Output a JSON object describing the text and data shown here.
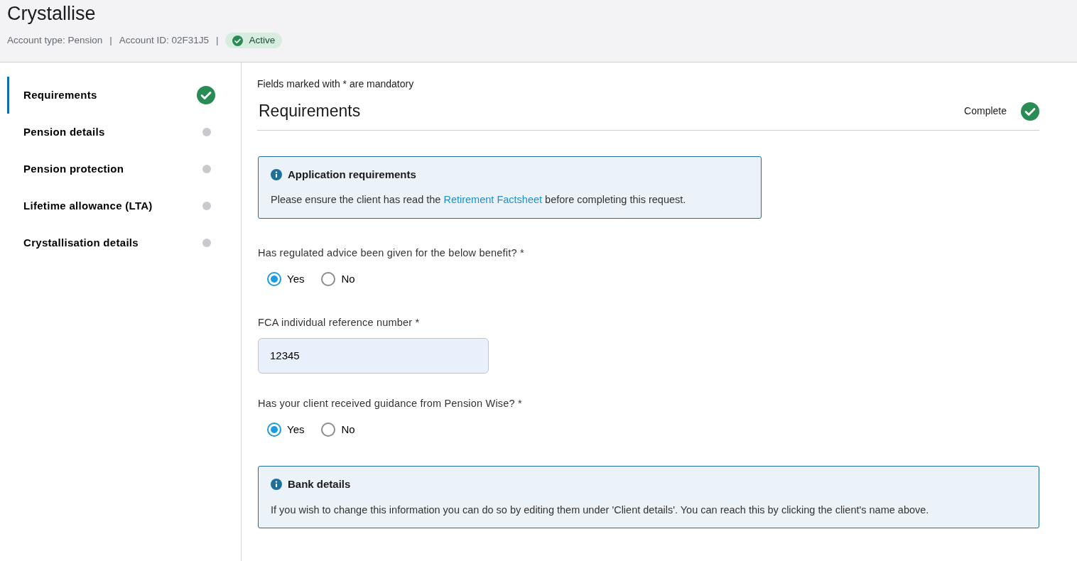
{
  "header": {
    "title": "Crystallise",
    "account_type": "Account type: Pension",
    "separator_1": "|",
    "account_id": "Account ID: 02F31J5",
    "separator_2": "|",
    "status": {
      "label": "Active",
      "kind": "active"
    }
  },
  "sidebar": {
    "items": [
      {
        "label": "Requirements",
        "selected": true,
        "complete": true
      },
      {
        "label": "Pension details",
        "selected": false,
        "complete": false
      },
      {
        "label": "Pension protection",
        "selected": false,
        "complete": false
      },
      {
        "label": "Lifetime allowance (LTA)",
        "selected": false,
        "complete": false
      },
      {
        "label": "Crystallisation details",
        "selected": false,
        "complete": false
      }
    ]
  },
  "mandatory_note": "Fields marked with * are mandatory",
  "section": {
    "title": "Requirements",
    "status": "Complete",
    "complete": true
  },
  "form": [
    {
      "kind": "notice",
      "title": "Application requirements",
      "text_before": "Please ensure the client has read the ",
      "link": "Retirement Factsheet",
      "text_after": " before completing this request."
    },
    {
      "kind": "radio",
      "label": "Has regulated advice been given for the below benefit?",
      "required_mark": "*",
      "options": [
        {
          "label": "Yes",
          "selected": true
        },
        {
          "label": "No",
          "selected": false
        }
      ]
    },
    {
      "kind": "input",
      "label": "FCA individual reference number",
      "required_mark": "*",
      "value": "12345"
    },
    {
      "kind": "radio",
      "label": "Has your client received guidance from Pension Wise?",
      "required_mark": "*",
      "options": [
        {
          "label": "Yes",
          "selected": true
        },
        {
          "label": "No",
          "selected": false
        }
      ]
    },
    {
      "kind": "notice",
      "wide": true,
      "title": "Bank details",
      "text_before": "If you wish to change this information you can do so by editing them under 'Client details'. You can reach this by clicking the client's name above."
    }
  ]
}
